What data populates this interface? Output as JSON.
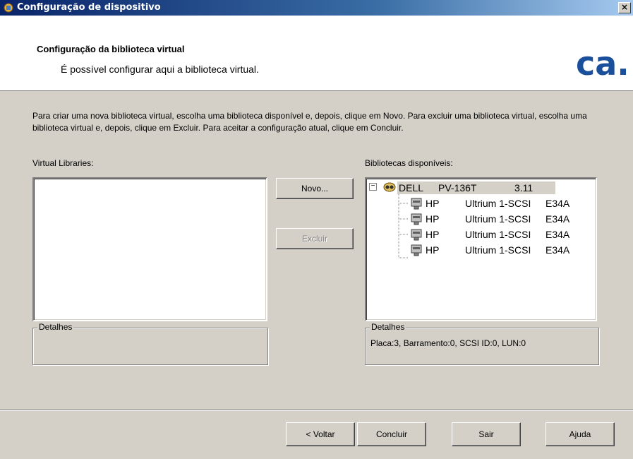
{
  "window": {
    "title": "Configuração de dispositivo",
    "close_glyph": "×"
  },
  "header": {
    "title": "Configuração da biblioteca virtual",
    "subtitle": "É possível configurar aqui a biblioteca virtual.",
    "logo_text": "ca."
  },
  "intro_text": "Para criar uma nova biblioteca virtual, escolha uma biblioteca disponível e, depois, clique em Novo. Para excluir uma biblioteca virtual, escolha uma biblioteca virtual e, depois, clique em Excluir. Para aceitar a configuração atual, clique em Concluir.",
  "virtual_libraries": {
    "label": "Virtual Libraries:",
    "items": [],
    "details_label": "Detalhes",
    "details_text": ""
  },
  "actions": {
    "new_label": "Novo...",
    "delete_label": "Excluir"
  },
  "available_libraries": {
    "label": "Bibliotecas disponíveis:",
    "root": {
      "vendor": "DELL",
      "model": "PV-136T",
      "version": "3.11",
      "expander": "−"
    },
    "drives": [
      {
        "vendor": "HP",
        "model": "Ultrium 1-SCSI",
        "rev": "E34A"
      },
      {
        "vendor": "HP",
        "model": "Ultrium 1-SCSI",
        "rev": "E34A"
      },
      {
        "vendor": "HP",
        "model": "Ultrium 1-SCSI",
        "rev": "E34A"
      },
      {
        "vendor": "HP",
        "model": "Ultrium 1-SCSI",
        "rev": "E34A"
      }
    ],
    "details_label": "Detalhes",
    "details_text": "Placa:3, Barramento:0, SCSI ID:0, LUN:0"
  },
  "footer": {
    "back_label": "< Voltar",
    "finish_label": "Concluir",
    "exit_label": "Sair",
    "help_label": "Ajuda"
  },
  "colors": {
    "titlebar_start": "#0a246a",
    "titlebar_end": "#a6caf0",
    "logo": "#1a4f9c",
    "dialog_bg": "#d4d0c8"
  }
}
